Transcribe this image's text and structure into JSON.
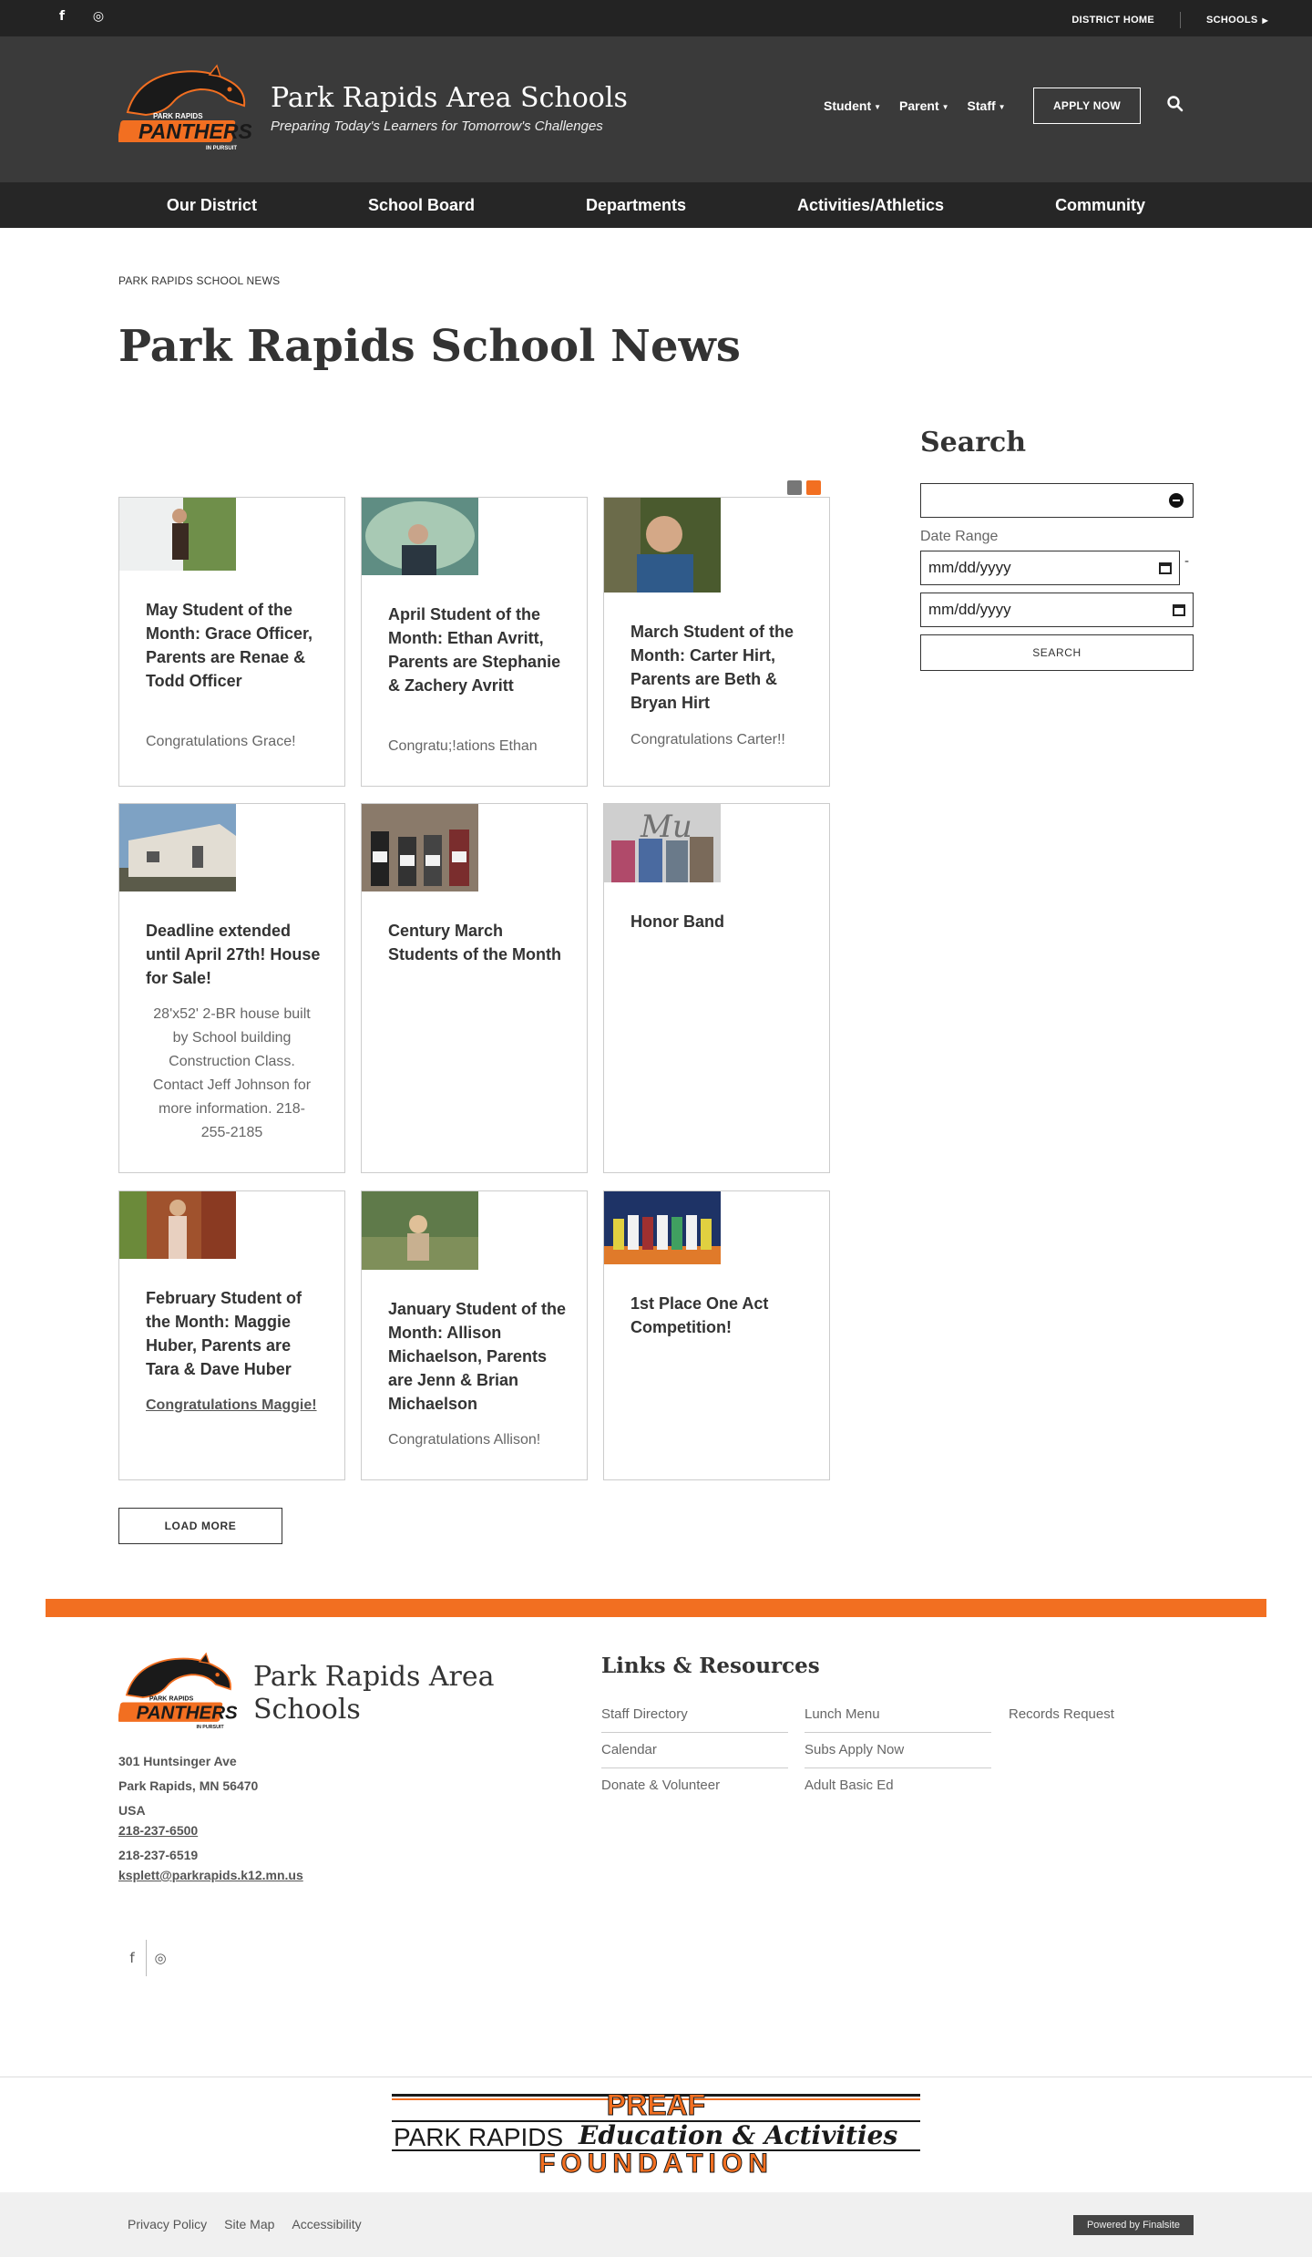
{
  "topbar": {
    "social": [
      "f",
      "◎"
    ],
    "district_home": "DISTRICT HOME",
    "schools": "SCHOOLS"
  },
  "header": {
    "title": "Park Rapids Area Schools",
    "tagline": "Preparing Today's Learners for Tomorrow's Challenges",
    "nav": [
      "Student",
      "Parent",
      "Staff"
    ],
    "apply": "APPLY NOW",
    "logo_text": "PANTHERS",
    "logo_top": "PARK RAPIDS",
    "logo_bottom": "IN PURSUIT"
  },
  "mainnav": [
    "Our District",
    "School Board",
    "Departments",
    "Activities/Athletics",
    "Community"
  ],
  "breadcrumb": "PARK RAPIDS SCHOOL NEWS",
  "page_title": "Park Rapids School News",
  "news": [
    {
      "title": "May Student of the Month: Grace Officer, Parents are Renae & Todd Officer",
      "desc": "Congratulations Grace!"
    },
    {
      "title": "April Student of the Month: Ethan Avritt, Parents are Stephanie & Zachery Avritt",
      "desc": "Congratu;!ations Ethan"
    },
    {
      "title": "March Student of the Month: Carter Hirt, Parents are Beth & Bryan Hirt",
      "desc": "Congratulations Carter!!"
    },
    {
      "title": "Deadline extended until April 27th! House for Sale!",
      "desc": "28'x52' 2-BR house built by School building Construction Class. Contact Jeff Johnson for more information. 218-255-2185"
    },
    {
      "title": "Century March Students of the Month",
      "desc": ""
    },
    {
      "title": "Honor Band",
      "desc": ""
    },
    {
      "title": "February Student of the Month: Maggie Huber, Parents are Tara & Dave Huber",
      "desc": "Congratulations Maggie!"
    },
    {
      "title": "January Student of the Month: Allison Michaelson, Parents are Jenn & Brian Michaelson",
      "desc": "Congratulations Allison!"
    },
    {
      "title": "1st Place One Act Competition!",
      "desc": ""
    }
  ],
  "load_more": "LOAD MORE",
  "search": {
    "title": "Search",
    "date_label": "Date Range",
    "date_placeholder": "mm/dd/yyyy",
    "dash": "-",
    "button": "SEARCH"
  },
  "footer": {
    "title": "Park Rapids Area Schools",
    "address": [
      "301 Huntsinger Ave",
      "Park Rapids, MN  56470",
      "USA"
    ],
    "phone": "218-237-6500",
    "fax": "218-237-6519",
    "email": "ksplett@parkrapids.k12.mn.us",
    "links_title": "Links & Resources",
    "links": [
      "Staff Directory",
      "Lunch Menu",
      "Records Request",
      "Calendar",
      "Subs Apply Now",
      "Donate & Volunteer",
      "Adult Basic Ed"
    ],
    "preaf_top": "PREAF",
    "preaf_mid": "PARK RAPIDS",
    "preaf_mid2": "Education & Activities",
    "preaf_bottom": "FOUNDATION",
    "bottom_links": [
      "Privacy Policy",
      "Site Map",
      "Accessibility"
    ],
    "powered": "Powered by Finalsite"
  },
  "colors": {
    "accent": "#f26f21",
    "header_bg": "#3a3a3a",
    "nav_bg": "#262626"
  }
}
